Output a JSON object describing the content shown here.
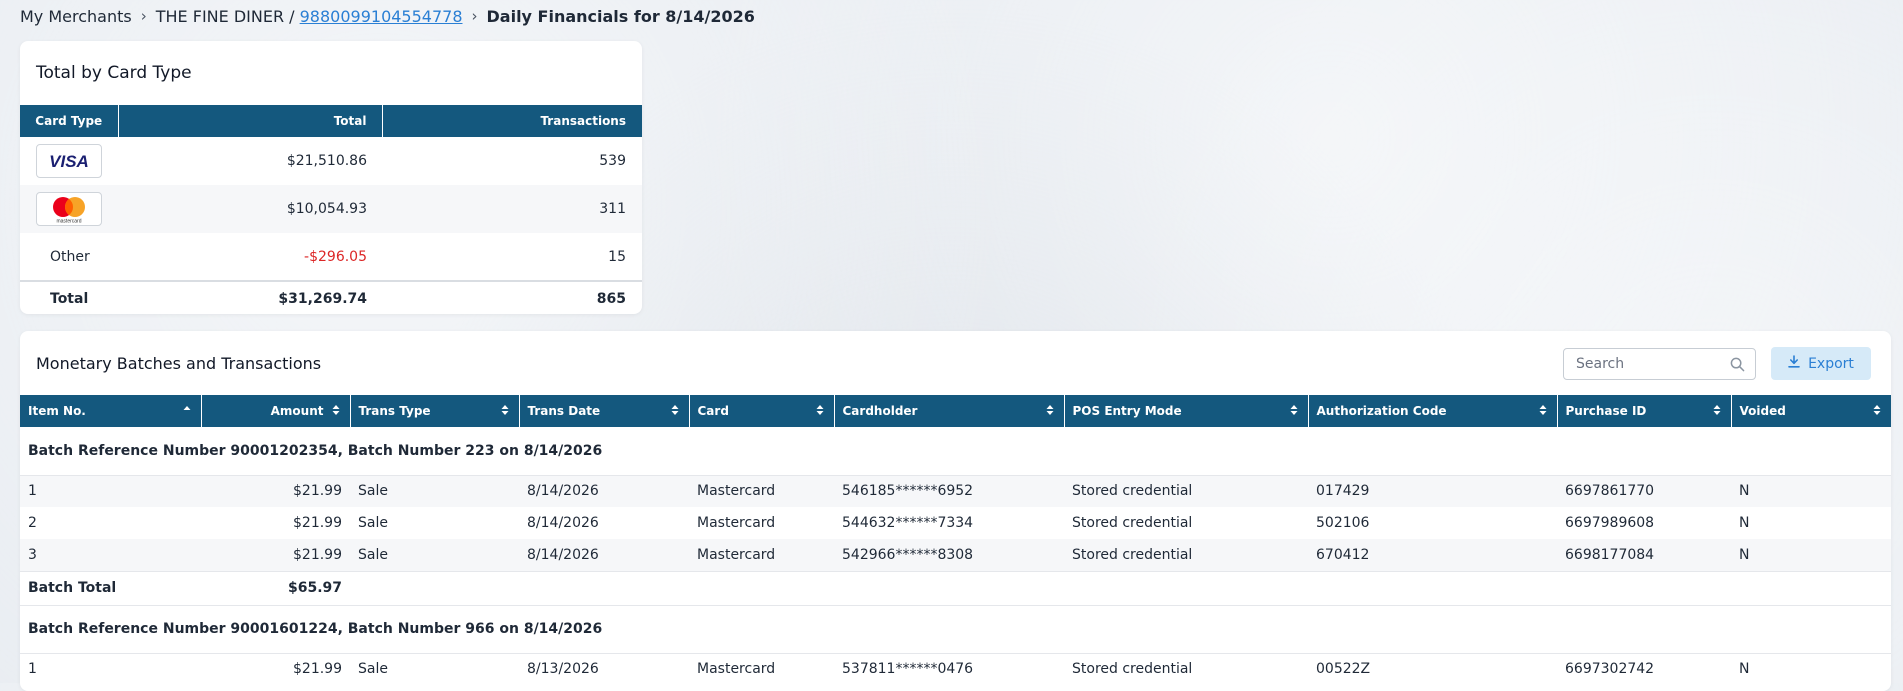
{
  "breadcrumb": {
    "root": "My Merchants",
    "merchant": "THE FINE DINER /",
    "merchant_id": "9880099104554778",
    "current": "Daily Financials for 8/14/2026"
  },
  "card_types": {
    "title": "Total by Card Type",
    "headers": {
      "type": "Card Type",
      "total": "Total",
      "transactions": "Transactions"
    },
    "rows": [
      {
        "type": "visa-logo",
        "total": "$21,510.86",
        "transactions": "539"
      },
      {
        "type": "mastercard-logo",
        "total": "$10,054.93",
        "transactions": "311"
      },
      {
        "type": "Other",
        "total": "-$296.05",
        "transactions": "15"
      }
    ],
    "visa_text": "VISA",
    "mastercard_text": "mastercard",
    "total_row": {
      "label": "Total",
      "total": "$31,269.74",
      "transactions": "865"
    }
  },
  "batches": {
    "title": "Monetary Batches and Transactions",
    "search_placeholder": "Search",
    "export_label": "Export",
    "columns": [
      "Item No.",
      "Amount",
      "Trans Type",
      "Trans Date",
      "Card",
      "Cardholder",
      "POS Entry Mode",
      "Authorization Code",
      "Purchase ID",
      "Voided"
    ],
    "groups": [
      {
        "header": "Batch Reference Number 90001202354, Batch Number 223 on 8/14/2026",
        "rows": [
          [
            "1",
            "$21.99",
            "Sale",
            "8/14/2026",
            "Mastercard",
            "546185******6952",
            "Stored credential",
            "017429",
            "6697861770",
            "N"
          ],
          [
            "2",
            "$21.99",
            "Sale",
            "8/14/2026",
            "Mastercard",
            "544632******7334",
            "Stored credential",
            "502106",
            "6697989608",
            "N"
          ],
          [
            "3",
            "$21.99",
            "Sale",
            "8/14/2026",
            "Mastercard",
            "542966******8308",
            "Stored credential",
            "670412",
            "6698177084",
            "N"
          ]
        ],
        "total_label": "Batch Total",
        "total_amount": "$65.97"
      },
      {
        "header": "Batch Reference Number 90001601224, Batch Number 966 on 8/14/2026",
        "rows": [
          [
            "1",
            "$21.99",
            "Sale",
            "8/13/2026",
            "Mastercard",
            "537811******0476",
            "Stored credential",
            "00522Z",
            "6697302742",
            "N"
          ]
        ]
      }
    ]
  },
  "colors": {
    "header_bg": "#14587e",
    "link": "#2a7fd4",
    "negative": "#dc2626",
    "export_bg": "#d6eaf8"
  }
}
